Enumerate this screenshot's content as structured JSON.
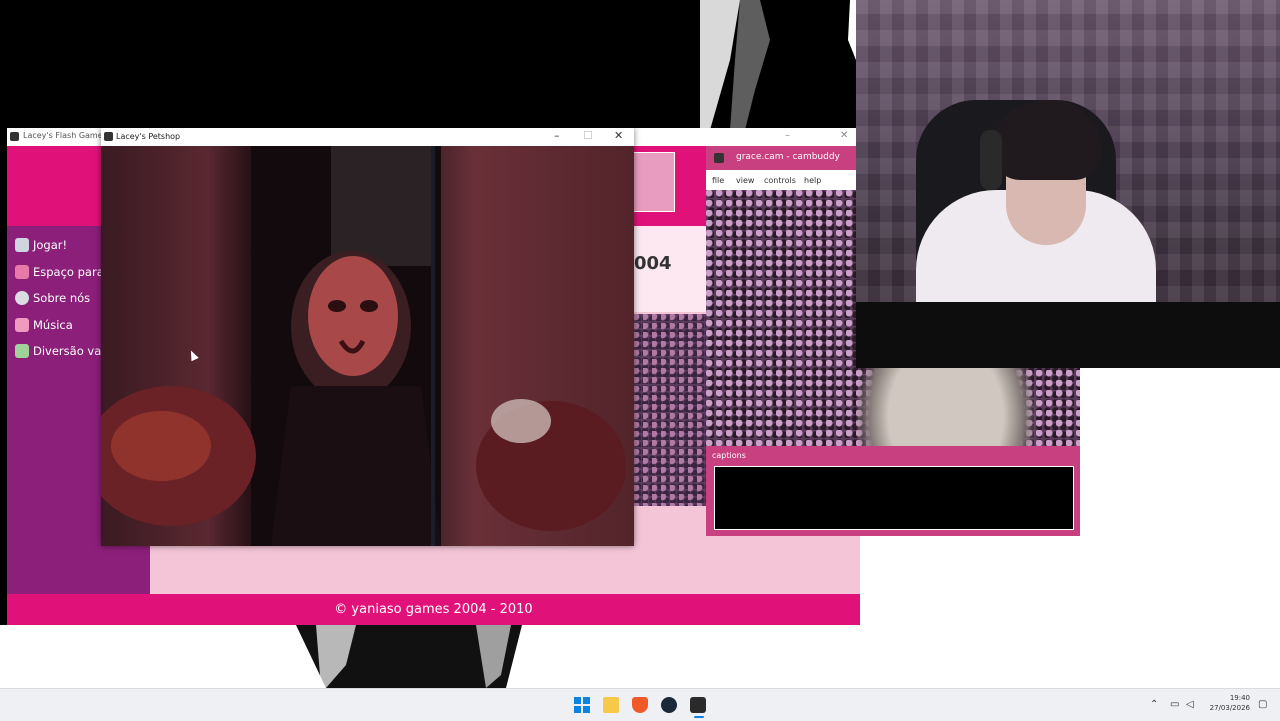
{
  "flash_window": {
    "title": "Lacey's Flash Games",
    "menu": [
      {
        "label": "Jogar!",
        "icon": "game-controller-icon"
      },
      {
        "label": "Espaço para t",
        "icon": "brush-icon"
      },
      {
        "label": "Sobre nós",
        "icon": "info-icon"
      },
      {
        "label": "Música",
        "icon": "music-icon"
      },
      {
        "label": "Diversão vari",
        "icon": "star-icon"
      }
    ],
    "year_fragment": "004",
    "footer": "© yaniaso games 2004 - 2010",
    "colors": {
      "accent": "#e0127a",
      "sidebar": "#8b1f7a",
      "content": "#f4c5d6"
    }
  },
  "petshop_window": {
    "title": "Lacey's Petshop",
    "controls": {
      "minimize": "–",
      "maximize": "☐",
      "close": "✕"
    }
  },
  "cam_window": {
    "title": "grace.cam - cambuddy",
    "menu": [
      "file",
      "view",
      "controls",
      "help"
    ],
    "captions_label": "captions",
    "captions_text": ""
  },
  "taskbar": {
    "apps": [
      "start",
      "file-explorer",
      "brave",
      "steam",
      "lacey-app"
    ],
    "time": "19:40",
    "date": "27/03/2026"
  }
}
